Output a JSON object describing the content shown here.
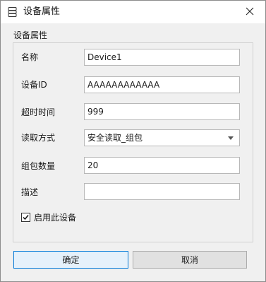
{
  "window": {
    "title": "设备属性",
    "icon": "device-list-icon",
    "close_icon": "close-icon"
  },
  "group": {
    "label": "设备属性"
  },
  "fields": {
    "name": {
      "label": "名称",
      "value": "Device1"
    },
    "device_id": {
      "label": "设备ID",
      "value": "AAAAAAAAAAAA"
    },
    "timeout": {
      "label": "超时时间",
      "value": "999"
    },
    "read_mode": {
      "label": "读取方式",
      "value": "安全读取_组包"
    },
    "packet_count": {
      "label": "组包数量",
      "value": "20"
    },
    "description": {
      "label": "描述",
      "value": ""
    }
  },
  "enable": {
    "label": "启用此设备",
    "checked": true
  },
  "buttons": {
    "ok": "确定",
    "cancel": "取消"
  },
  "colors": {
    "accent": "#0078d7",
    "background": "#f0f0f0"
  }
}
